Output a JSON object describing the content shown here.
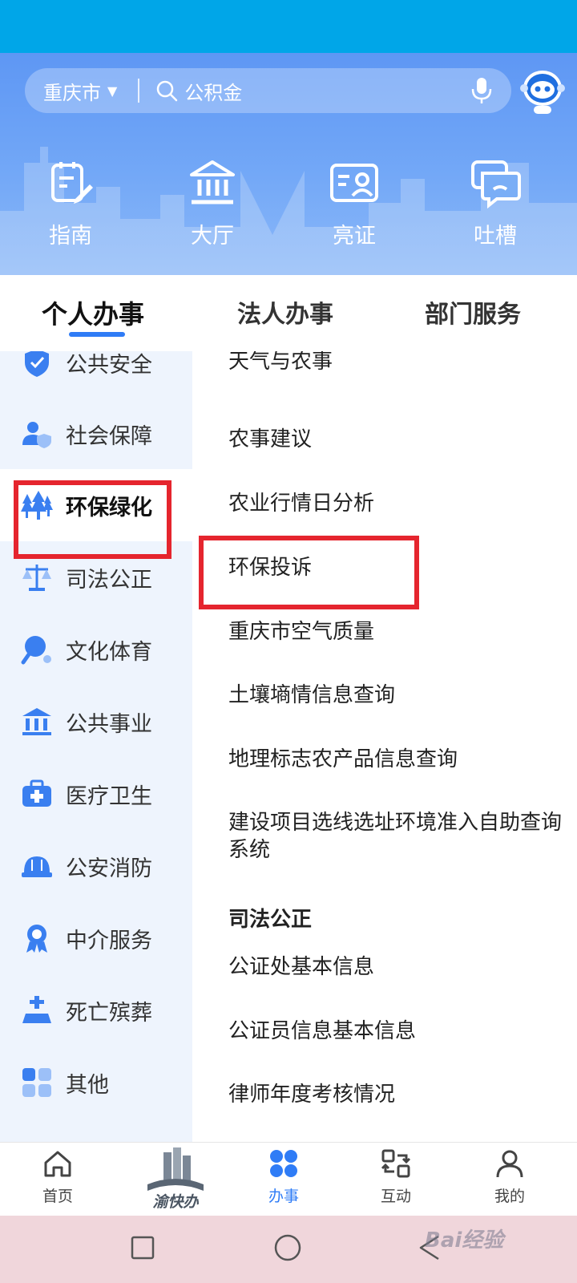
{
  "search": {
    "city": "重庆市",
    "placeholder": "公积金"
  },
  "quick_actions": [
    {
      "label": "指南",
      "icon": "guide-icon"
    },
    {
      "label": "大厅",
      "icon": "hall-icon"
    },
    {
      "label": "亮证",
      "icon": "id-card-icon"
    },
    {
      "label": "吐槽",
      "icon": "feedback-icon"
    }
  ],
  "tabs": [
    {
      "label": "个人办事",
      "active": true
    },
    {
      "label": "法人办事",
      "active": false
    },
    {
      "label": "部门服务",
      "active": false
    }
  ],
  "sidebar": [
    {
      "label": "公共安全",
      "icon": "shield-icon"
    },
    {
      "label": "社会保障",
      "icon": "social-security-icon"
    },
    {
      "label": "环保绿化",
      "icon": "trees-icon",
      "active": true
    },
    {
      "label": "司法公正",
      "icon": "scales-icon"
    },
    {
      "label": "文化体育",
      "icon": "ping-pong-icon"
    },
    {
      "label": "公共事业",
      "icon": "building-icon"
    },
    {
      "label": "医疗卫生",
      "icon": "medical-kit-icon"
    },
    {
      "label": "公安消防",
      "icon": "helmet-icon"
    },
    {
      "label": "中介服务",
      "icon": "badge-icon"
    },
    {
      "label": "死亡殡葬",
      "icon": "tomb-icon"
    },
    {
      "label": "其他",
      "icon": "grid-icon"
    }
  ],
  "content": {
    "items": [
      "天气与农事",
      "农事建议",
      "农业行情日分析",
      "环保投诉",
      "重庆市空气质量",
      "土壤墒情信息查询",
      "地理标志农产品信息查询",
      "建设项目选线选址环境准入自助查询系统"
    ],
    "section_header": "司法公正",
    "section_items": [
      "公证处基本信息",
      "公证员信息基本信息",
      "律师年度考核情况"
    ]
  },
  "bottom_nav": [
    {
      "label": "首页",
      "icon": "home-icon"
    },
    {
      "label": "渝快办",
      "icon": "app-logo"
    },
    {
      "label": "办事",
      "icon": "services-icon",
      "active": true
    },
    {
      "label": "互动",
      "icon": "interaction-icon"
    },
    {
      "label": "我的",
      "icon": "profile-icon"
    }
  ],
  "watermark": "Bai经验",
  "colors": {
    "accent": "#2f7cf6",
    "highlight": "#e5252e",
    "status_bar": "#00a6e8"
  }
}
